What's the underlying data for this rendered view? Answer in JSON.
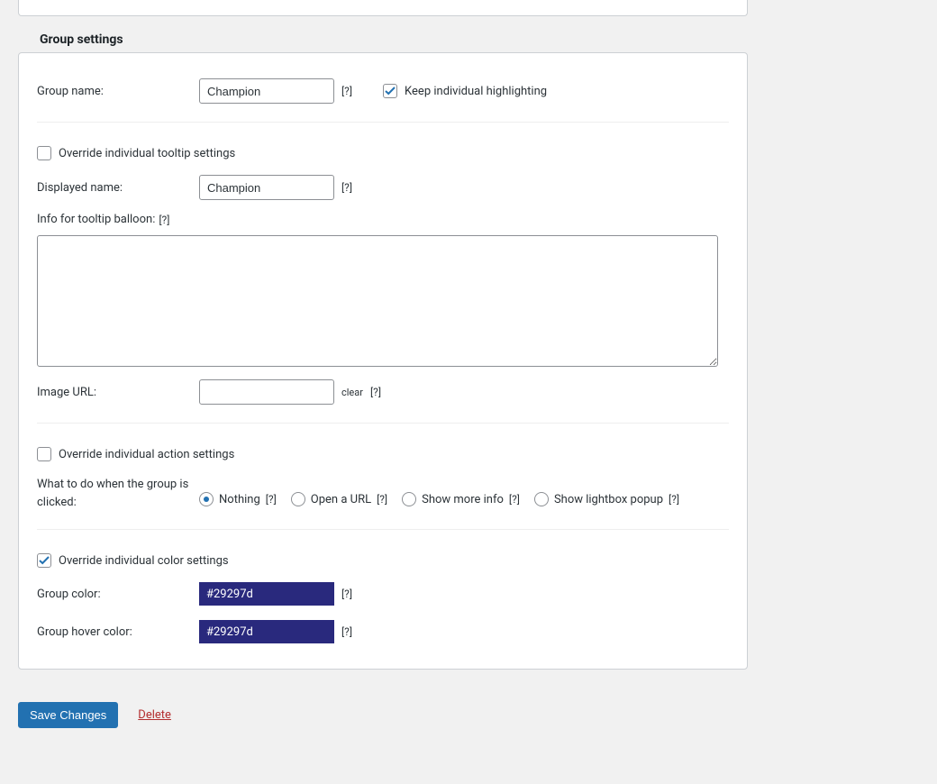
{
  "section_title": "Group settings",
  "group_name": {
    "label": "Group name:",
    "value": "Champion",
    "help": "[?]"
  },
  "keep_highlight": {
    "checked": true,
    "label": "Keep individual highlighting"
  },
  "override_tooltip": {
    "checked": false,
    "label": "Override individual tooltip settings"
  },
  "displayed_name": {
    "label": "Displayed name:",
    "value": "Champion",
    "help": "[?]"
  },
  "tooltip_info": {
    "label": "Info for tooltip balloon:",
    "help": "[?]",
    "value": ""
  },
  "image_url": {
    "label": "Image URL:",
    "value": "",
    "clear": "clear",
    "help": "[?]"
  },
  "override_action": {
    "checked": false,
    "label": "Override individual action settings"
  },
  "click_action": {
    "label": "What to do when the group is clicked:",
    "selected": 0,
    "options": [
      {
        "label": "Nothing",
        "help": "[?]"
      },
      {
        "label": "Open a URL",
        "help": "[?]"
      },
      {
        "label": "Show more info",
        "help": "[?]"
      },
      {
        "label": "Show lightbox popup",
        "help": "[?]"
      }
    ]
  },
  "override_color": {
    "checked": true,
    "label": "Override individual color settings"
  },
  "group_color": {
    "label": "Group color:",
    "value": "#29297d",
    "hex": "#29297d",
    "help": "[?]"
  },
  "group_hover_color": {
    "label": "Group hover color:",
    "value": "#29297d",
    "hex": "#29297d",
    "help": "[?]"
  },
  "footer": {
    "save": "Save Changes",
    "delete": "Delete"
  }
}
